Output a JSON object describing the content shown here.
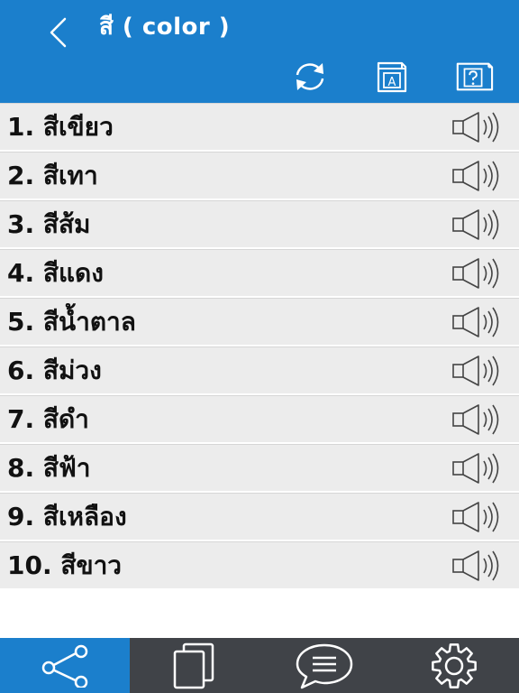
{
  "header": {
    "title": "สี ( color )",
    "color": "#1b7fcc"
  },
  "toolbar": {
    "icons": [
      "refresh-icon",
      "dictionary-icon",
      "help-icon"
    ]
  },
  "list": {
    "items": [
      {
        "label": "1. สีเขียว"
      },
      {
        "label": "2. สีเทา"
      },
      {
        "label": "3. สีส้ม"
      },
      {
        "label": "4. สีแดง"
      },
      {
        "label": "5. สีน้ำตาล"
      },
      {
        "label": "6. สีม่วง"
      },
      {
        "label": "7. สีดำ"
      },
      {
        "label": "8. สีฟ้า"
      },
      {
        "label": "9. สีเหลือง"
      },
      {
        "label": "10. สีขาว"
      }
    ],
    "row_icon": "speaker-icon"
  },
  "bottom_bar": {
    "items": [
      "share-icon",
      "copy-icon",
      "chat-icon",
      "settings-icon"
    ],
    "active": "share-icon",
    "color": "#404348"
  }
}
